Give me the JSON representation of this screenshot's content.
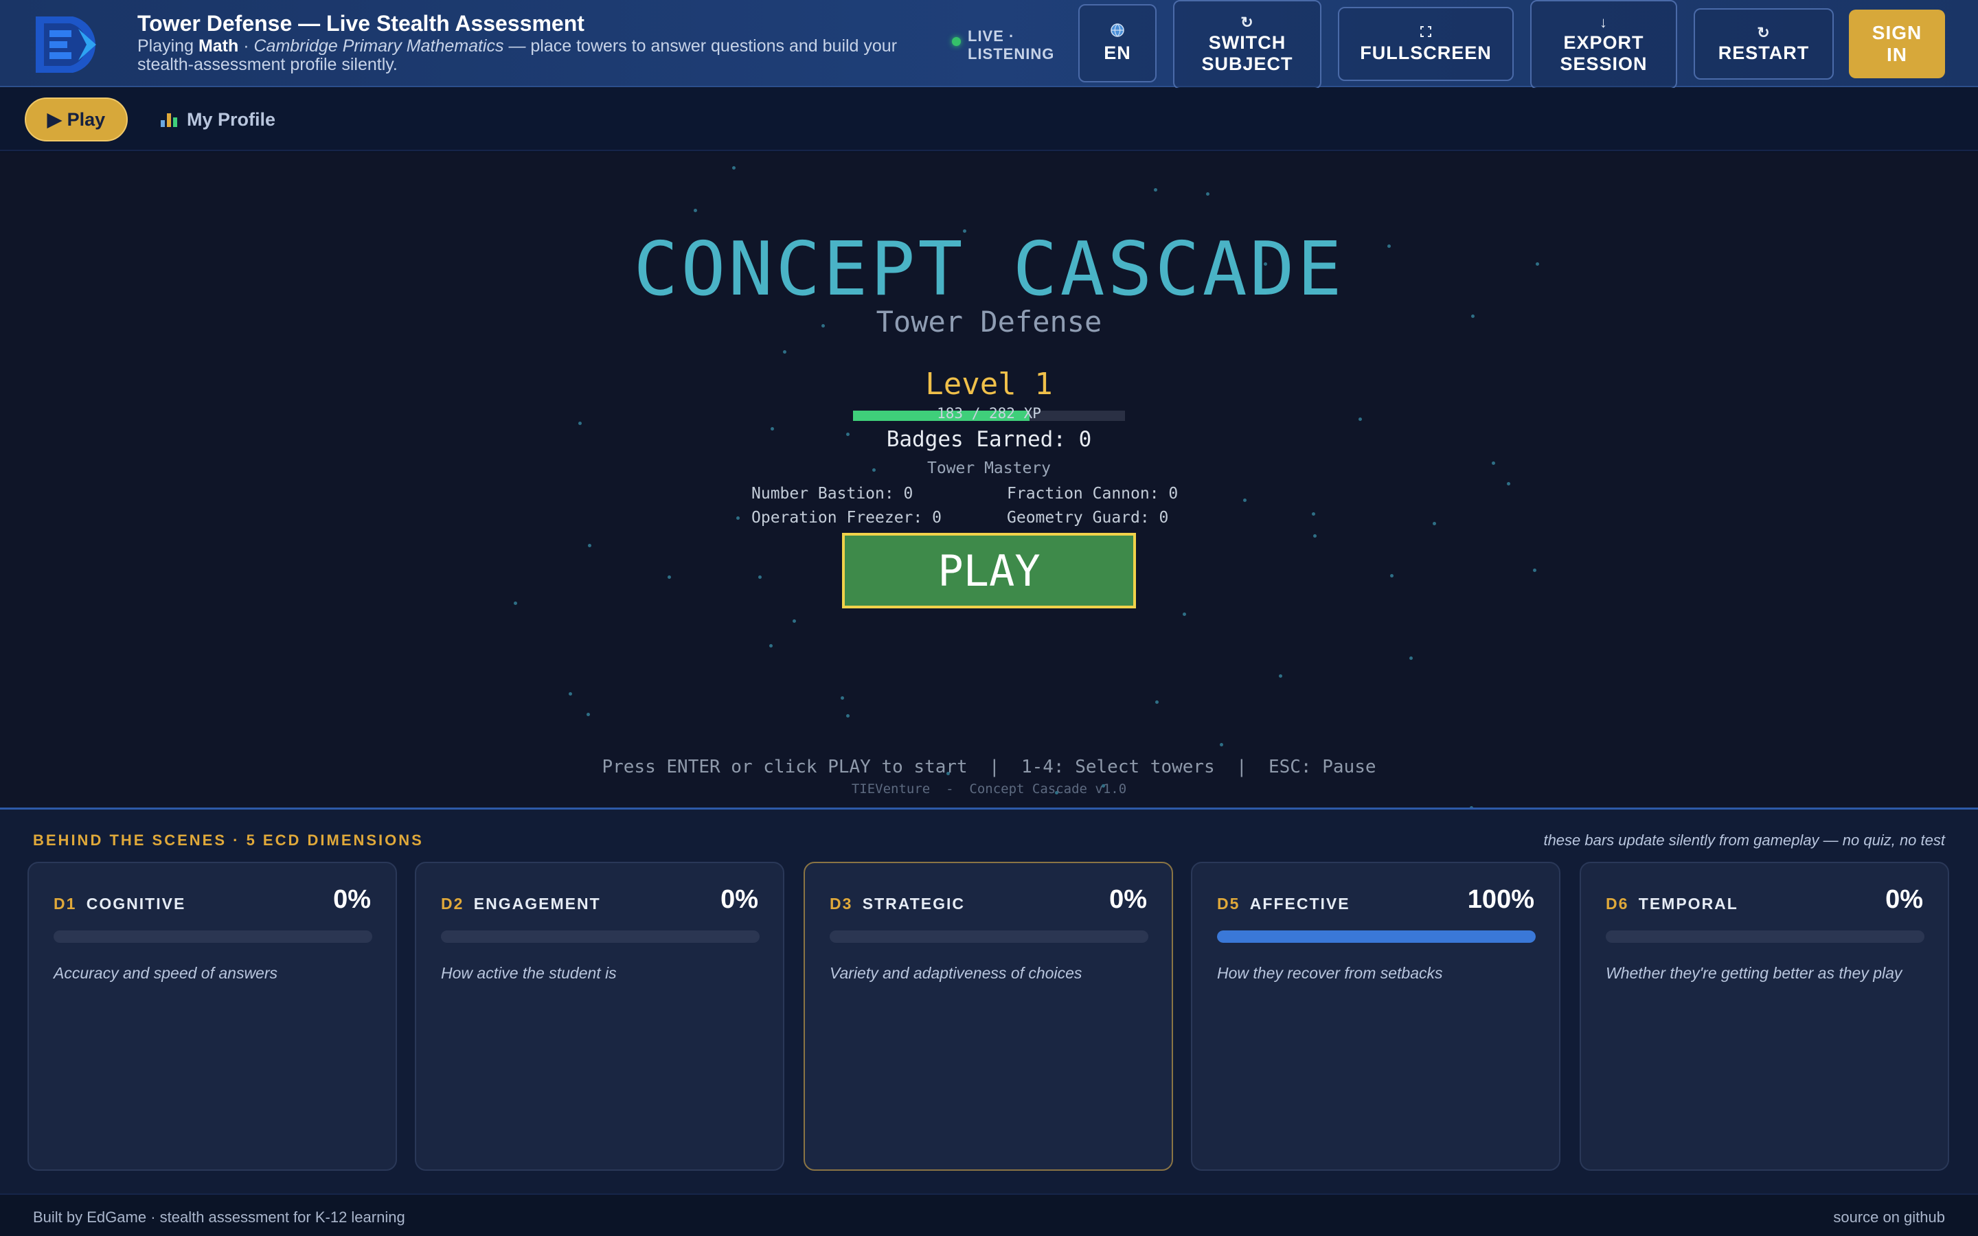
{
  "header": {
    "title": "Tower Defense — Live Stealth Assessment",
    "subtitle_prefix": "Playing ",
    "subject": "Math",
    "separator": " · ",
    "curriculum": "Cambridge Primary Mathematics",
    "subtitle_suffix": " — place towers to answer questions and build your stealth-assessment profile silently.",
    "live_status": "LIVE · LISTENING",
    "buttons": {
      "language": {
        "icon": "globe-icon",
        "label": "EN"
      },
      "switch_subject": {
        "icon": "cycle-icon",
        "label": "SWITCH SUBJECT"
      },
      "fullscreen": {
        "icon": "fullscreen-icon",
        "label": "FULLSCREEN"
      },
      "export_session": {
        "icon": "download-icon",
        "label": "EXPORT SESSION"
      },
      "restart": {
        "icon": "restart-icon",
        "label": "RESTART"
      },
      "sign_in": {
        "label": "SIGN IN"
      }
    }
  },
  "nav": {
    "play": {
      "icon": "play-icon",
      "label": "Play"
    },
    "profile": {
      "icon": "bar-chart-icon",
      "label": "My Profile"
    }
  },
  "game": {
    "title": "CONCEPT CASCADE",
    "subtitle": "Tower Defense",
    "level": "Level 1",
    "xp_current": 183,
    "xp_max": 282,
    "xp_text": "183 / 282 XP",
    "badges": "Badges Earned: 0",
    "mastery_title": "Tower Mastery",
    "towers": [
      "Number Bastion: 0",
      "Fraction Cannon: 0",
      "Operation Freezer: 0",
      "Geometry Guard: 0"
    ],
    "play_button": "PLAY",
    "hint": "Press ENTER or click PLAY to start  |  1-4: Select towers  |  ESC: Pause",
    "version": "TIEVenture  -  Concept Cascade v1.0"
  },
  "dimensions": {
    "title": "BEHIND THE SCENES · 5 ECD DIMENSIONS",
    "note": "these bars update silently from gameplay — no quiz, no test",
    "cards": [
      {
        "code": "D1",
        "name": "COGNITIVE",
        "percent": "0%",
        "value": 0,
        "description": "Accuracy and speed of answers"
      },
      {
        "code": "D2",
        "name": "ENGAGEMENT",
        "percent": "0%",
        "value": 0,
        "description": "How active the student is"
      },
      {
        "code": "D3",
        "name": "STRATEGIC",
        "percent": "0%",
        "value": 0,
        "description": "Variety and adaptiveness of choices"
      },
      {
        "code": "D5",
        "name": "AFFECTIVE",
        "percent": "100%",
        "value": 100,
        "description": "How they recover from setbacks"
      },
      {
        "code": "D6",
        "name": "TEMPORAL",
        "percent": "0%",
        "value": 0,
        "description": "Whether they're getting better as they play"
      }
    ]
  },
  "footer": {
    "left": "Built by EdGame · stealth assessment for K-12 learning",
    "right": "source on github"
  },
  "colors": {
    "accent_gold": "#d7a83a",
    "header_blue": "#1f3f78",
    "game_title": "#4ab3c6",
    "xp_green": "#3fcf7a",
    "play_green": "#3e8a4a",
    "bar_blue": "#3a78d8"
  }
}
